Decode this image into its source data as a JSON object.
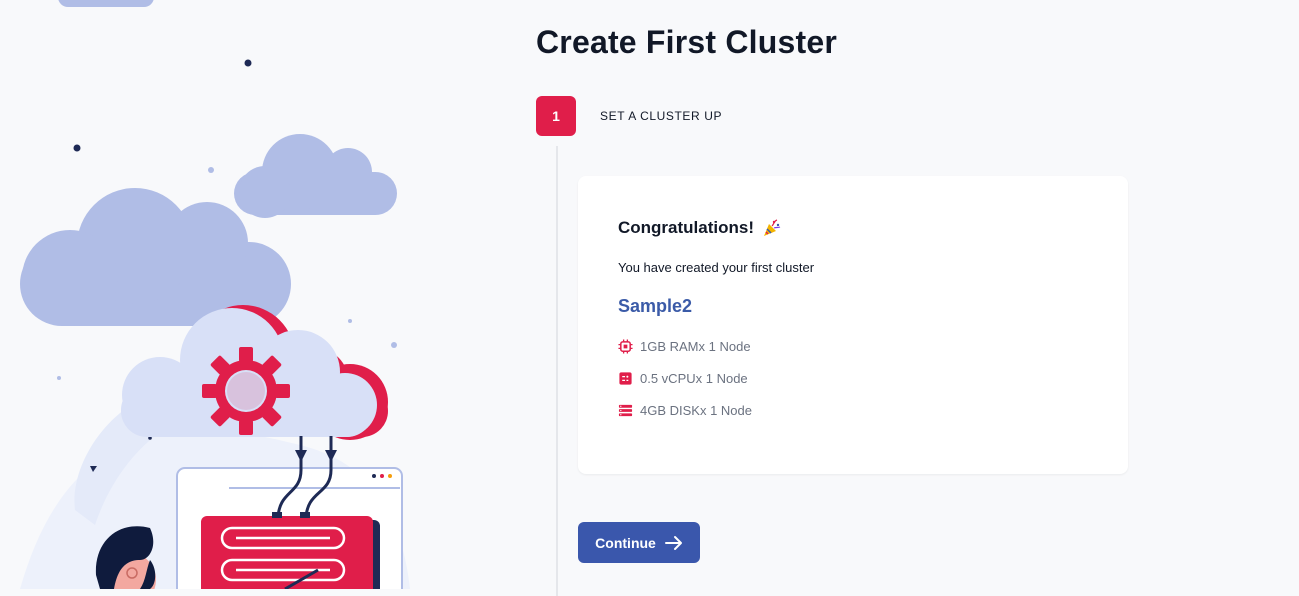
{
  "page": {
    "title": "Create First Cluster"
  },
  "step": {
    "number": "1",
    "label": "SET A CLUSTER UP"
  },
  "card": {
    "heading": "Congratulations!",
    "heading_icon": "party-popper-icon",
    "subtitle": "You have created your first cluster",
    "cluster_name": "Sample2",
    "specs": [
      {
        "icon": "memory-chip-icon",
        "text": "1GB RAMx 1 Node"
      },
      {
        "icon": "cpu-icon",
        "text": "0.5 vCPUx 1 Node"
      },
      {
        "icon": "disk-icon",
        "text": "4GB DISKx 1 Node"
      }
    ]
  },
  "actions": {
    "continue_label": "Continue",
    "continue_icon": "arrow-right-icon"
  },
  "colors": {
    "accent": "#e01e4a",
    "primary": "#3a57ac",
    "link": "#3b5ba8",
    "cloud": "#b0bde6"
  }
}
